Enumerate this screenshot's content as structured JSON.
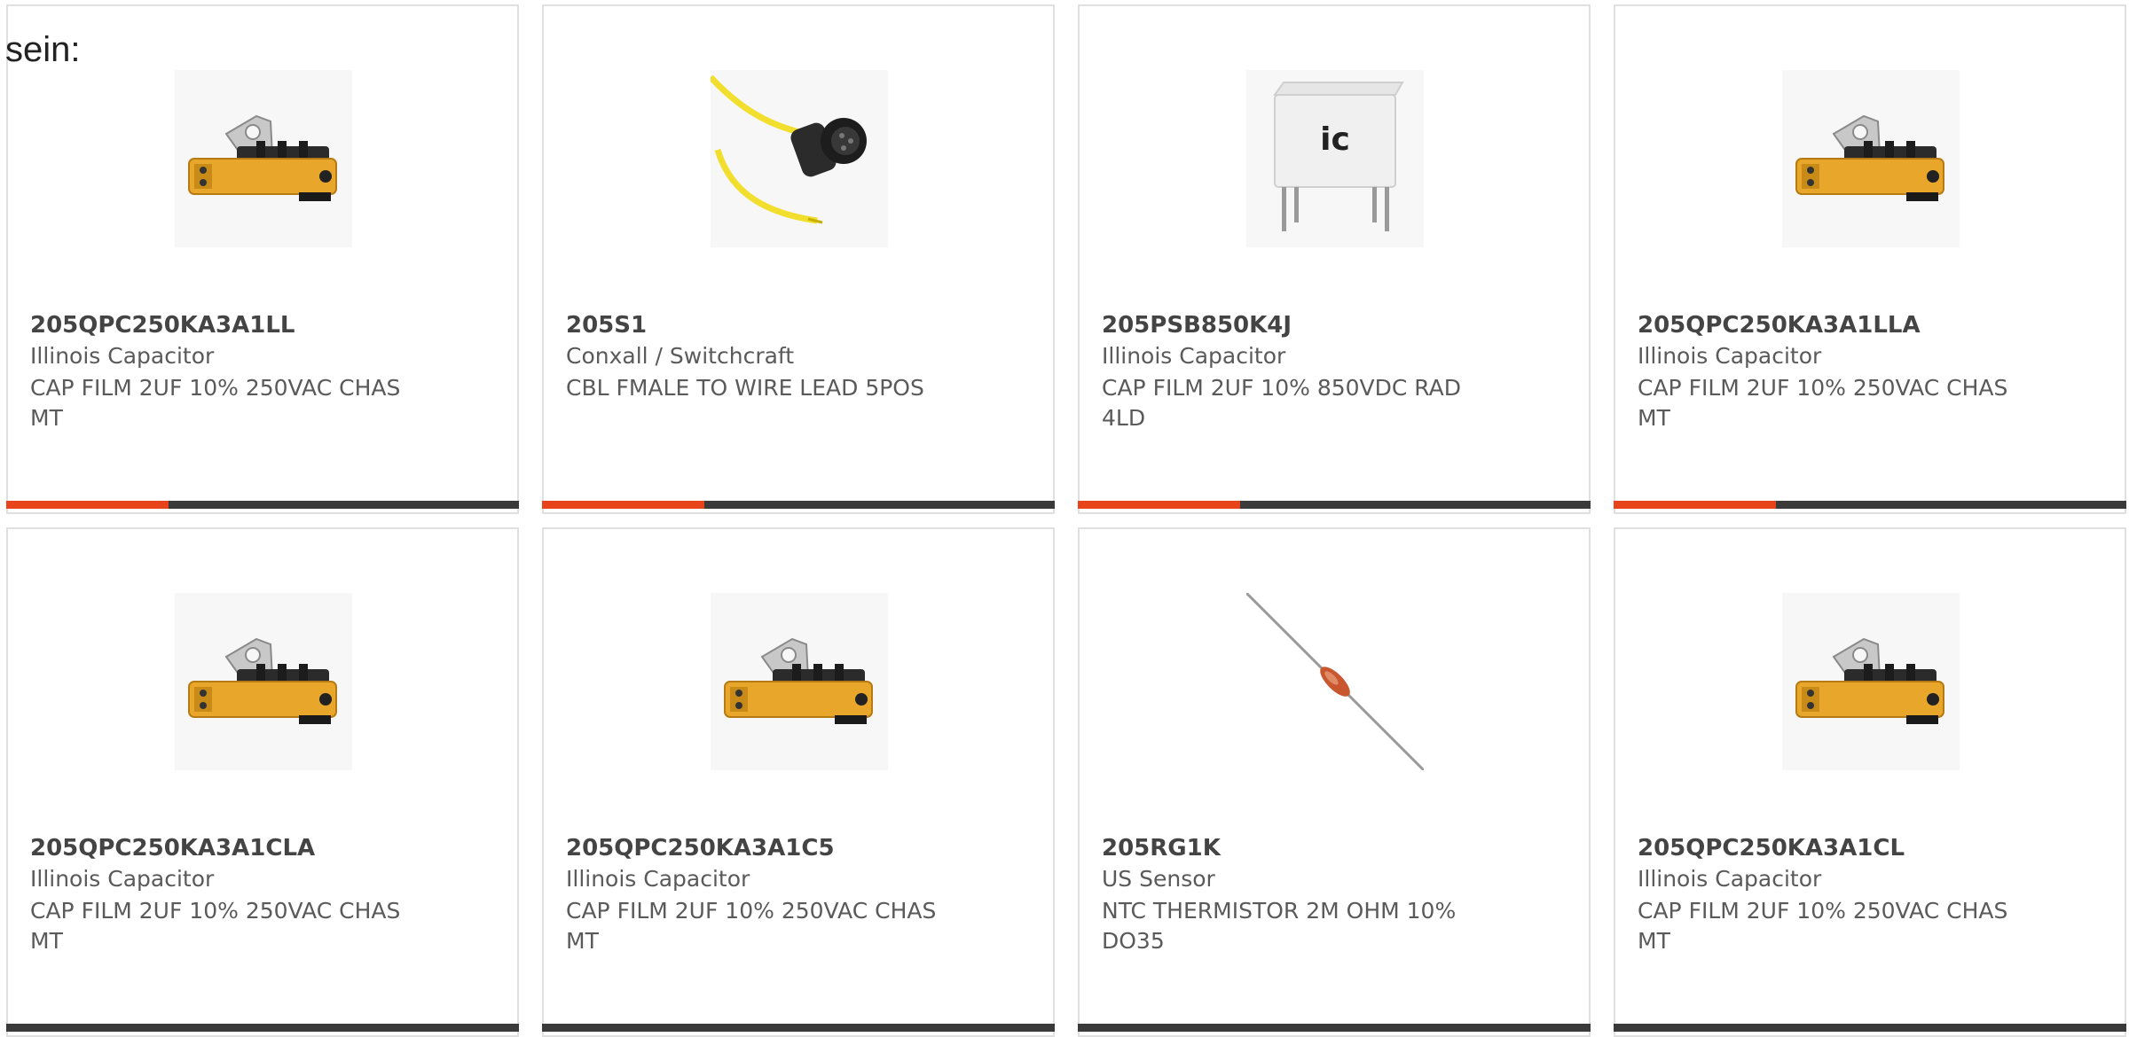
{
  "heading": "sein:",
  "accent_color": "#e8441c",
  "bar_color": "#3a3a3a",
  "products": [
    {
      "part_number": "205QPC250KA3A1LL",
      "manufacturer": "Illinois Capacitor",
      "description": "CAP FILM 2UF 10% 250VAC CHAS MT",
      "image": "chassis-capacitor-icon"
    },
    {
      "part_number": "205S1",
      "manufacturer": "Conxall / Switchcraft",
      "description": "CBL FMALE TO WIRE LEAD 5POS",
      "image": "cable-connector-icon"
    },
    {
      "part_number": "205PSB850K4J",
      "manufacturer": "Illinois Capacitor",
      "description": "CAP FILM 2UF 10% 850VDC RAD 4LD",
      "image": "radial-capacitor-icon"
    },
    {
      "part_number": "205QPC250KA3A1LLA",
      "manufacturer": "Illinois Capacitor",
      "description": "CAP FILM 2UF 10% 250VAC CHAS MT",
      "image": "chassis-capacitor-icon"
    },
    {
      "part_number": "205QPC250KA3A1CLA",
      "manufacturer": "Illinois Capacitor",
      "description": "CAP FILM 2UF 10% 250VAC CHAS MT",
      "image": "chassis-capacitor-icon"
    },
    {
      "part_number": "205QPC250KA3A1C5",
      "manufacturer": "Illinois Capacitor",
      "description": "CAP FILM 2UF 10% 250VAC CHAS MT",
      "image": "chassis-capacitor-icon"
    },
    {
      "part_number": "205RG1K",
      "manufacturer": "US Sensor",
      "description": "NTC THERMISTOR 2M OHM 10% DO35",
      "image": "thermistor-icon"
    },
    {
      "part_number": "205QPC250KA3A1CL",
      "manufacturer": "Illinois Capacitor",
      "description": "CAP FILM 2UF 10% 250VAC CHAS MT",
      "image": "chassis-capacitor-icon"
    }
  ],
  "icon_text": {
    "radial_capacitor_logo": "ic"
  }
}
